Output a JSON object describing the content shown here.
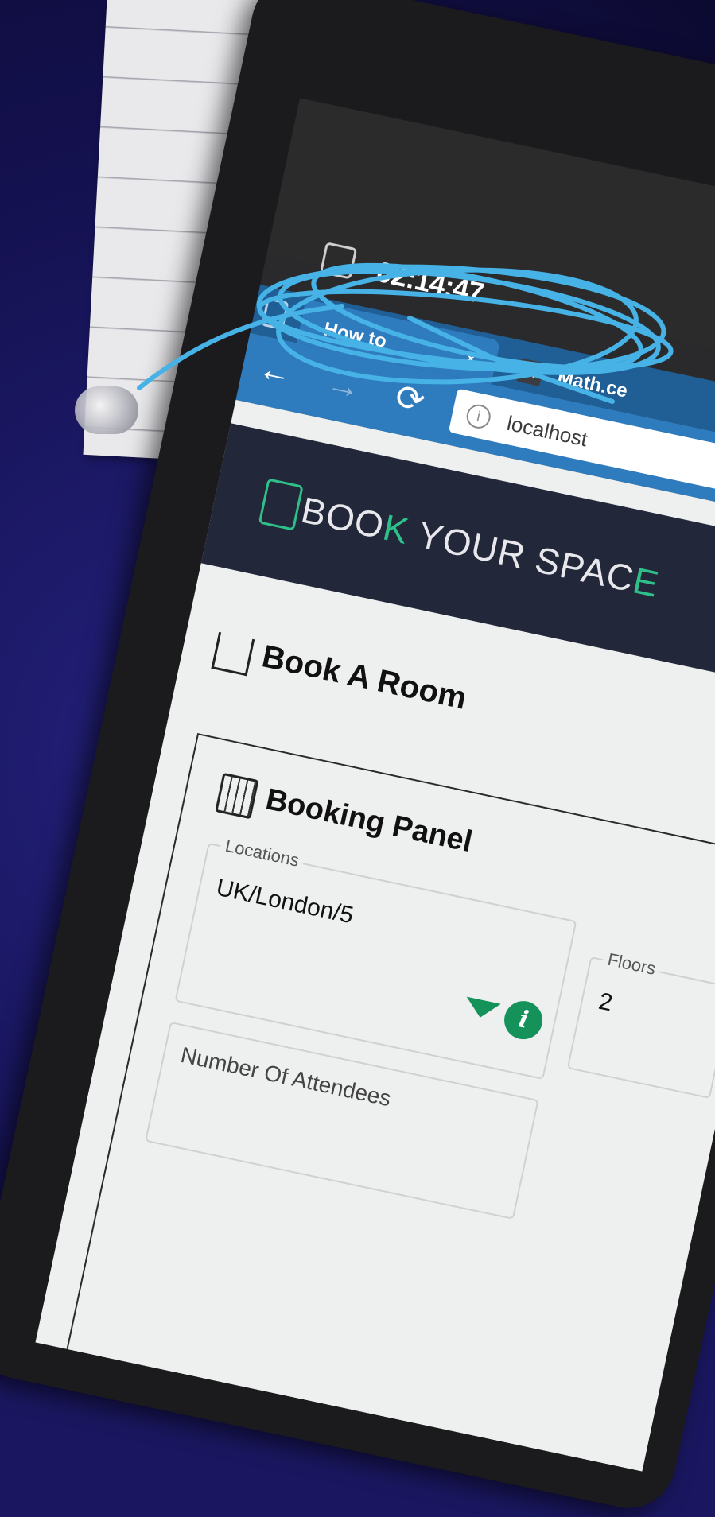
{
  "taskbar": {
    "clock": "02:14:47"
  },
  "browser": {
    "tabs": [
      {
        "title": "How to",
        "close_glyph": "×"
      },
      {
        "favicon_letter": "M",
        "title": "Math.ce"
      }
    ],
    "nav": {
      "back": "←",
      "forward": "→",
      "reload": "⟳"
    },
    "address": "localhost",
    "info_glyph": "i"
  },
  "page": {
    "logo": {
      "part1": "BOO",
      "part2": "K",
      "part3": " YOUR SPAC",
      "part4": "E"
    },
    "heading": "Book A Room",
    "panel": {
      "title": "Booking Panel",
      "locations": {
        "label": "Locations",
        "value": "UK/London/5"
      },
      "floors": {
        "label": "Floors",
        "value": "2"
      },
      "attendees": {
        "label": "Number Of Attendees"
      },
      "info_glyph": "i"
    }
  },
  "colors": {
    "tab_bar": "#1f5f95",
    "nav_bar": "#2e7bbd",
    "banner": "#22273a",
    "accent_green": "#2fc08a",
    "button_green": "#14925a",
    "annotation_scribble": "#46b2e6"
  }
}
